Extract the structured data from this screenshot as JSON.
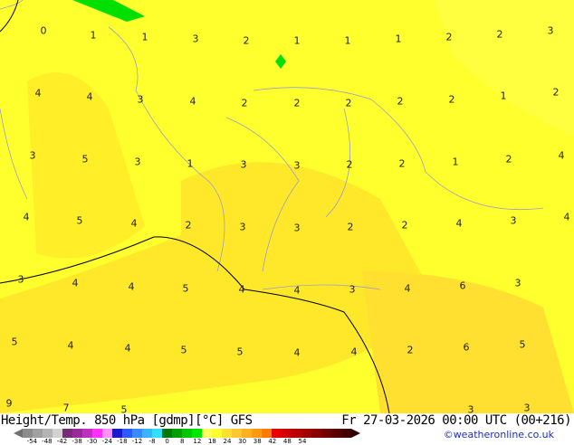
{
  "map": {
    "labels": [
      "0",
      "1",
      "1",
      "3",
      "2",
      "1",
      "1",
      "1",
      "2",
      "2",
      "3",
      "4",
      "4",
      "3",
      "4",
      "2",
      "2",
      "2",
      "2",
      "2",
      "1",
      "2",
      "3",
      "5",
      "3",
      "1",
      "3",
      "3",
      "2",
      "2",
      "1",
      "2",
      "4",
      "4",
      "5",
      "4",
      "2",
      "3",
      "3",
      "2",
      "2",
      "4",
      "3",
      "4",
      "3",
      "4",
      "4",
      "5",
      "4",
      "4",
      "3",
      "4",
      "6",
      "3",
      "5",
      "4",
      "4",
      "5",
      "5",
      "4",
      "4",
      "2",
      "6",
      "5",
      "9",
      "7",
      "5",
      "3",
      "3"
    ]
  },
  "footer": {
    "title": "Height/Temp. 850 hPa [gdmp][°C] GFS",
    "date": "Fr 27-03-2026 00:00 UTC (00+216)",
    "credit": "©weatheronline.co.uk"
  },
  "colorbar": {
    "ticks": [
      "-54",
      "-48",
      "-42",
      "-38",
      "-30",
      "-24",
      "-18",
      "-12",
      "-8",
      "0",
      "8",
      "12",
      "18",
      "24",
      "30",
      "38",
      "42",
      "48",
      "54"
    ],
    "colors": [
      "#8c8c8c",
      "#a0a0a0",
      "#b4b4b4",
      "#d2d2d2",
      "#7a2a7a",
      "#9a2a9a",
      "#c030c0",
      "#ff30ff",
      "#ff90ff",
      "#1a1acc",
      "#2a5aff",
      "#3a8aff",
      "#3ab4ff",
      "#30e0ff",
      "#007a00",
      "#00a000",
      "#00c800",
      "#00e800",
      "#ffff60",
      "#ffff30",
      "#ffe030",
      "#ffc830",
      "#ffb020",
      "#ff9a10",
      "#ff7a00",
      "#e80000",
      "#d00000",
      "#b80000",
      "#a00000",
      "#880000",
      "#700000",
      "#580000",
      "#400000"
    ]
  },
  "colors": {
    "background": "#ffff2e",
    "warm_region": "#ffe82a",
    "green": "#00e000"
  }
}
